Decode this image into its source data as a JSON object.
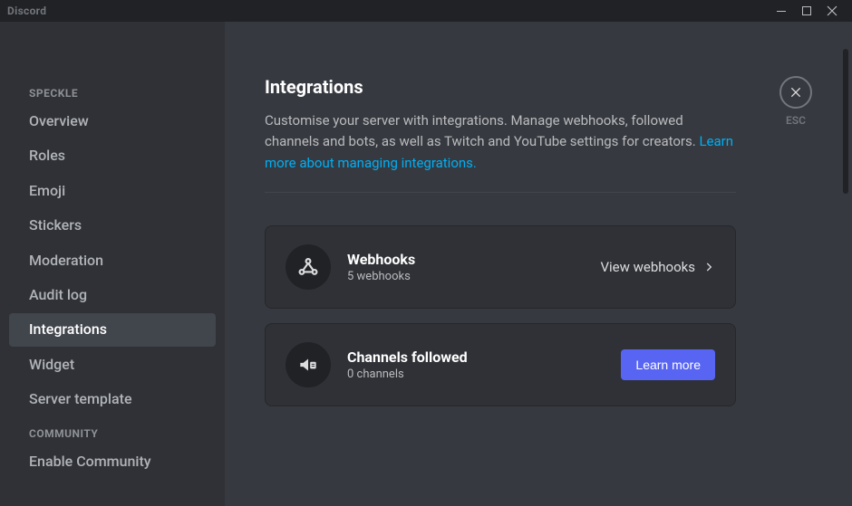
{
  "app": {
    "name": "Discord"
  },
  "sidebar": {
    "section1_heading": "SPECKLE",
    "section1_items": [
      {
        "label": "Overview"
      },
      {
        "label": "Roles"
      },
      {
        "label": "Emoji"
      },
      {
        "label": "Stickers"
      },
      {
        "label": "Moderation"
      },
      {
        "label": "Audit log"
      },
      {
        "label": "Integrations"
      },
      {
        "label": "Widget"
      },
      {
        "label": "Server template"
      }
    ],
    "section2_heading": "COMMUNITY",
    "section2_items": [
      {
        "label": "Enable Community"
      }
    ]
  },
  "page": {
    "title": "Integrations",
    "description_before_link": "Customise your server with integrations. Manage webhooks, followed channels and bots, as well as Twitch and YouTube settings for creators. ",
    "description_link": "Learn more about managing integrations.",
    "esc_label": "ESC"
  },
  "cards": {
    "webhooks": {
      "title": "Webhooks",
      "subtitle": "5 webhooks",
      "action": "View webhooks"
    },
    "channels": {
      "title": "Channels followed",
      "subtitle": "0 channels",
      "action": "Learn more"
    }
  }
}
